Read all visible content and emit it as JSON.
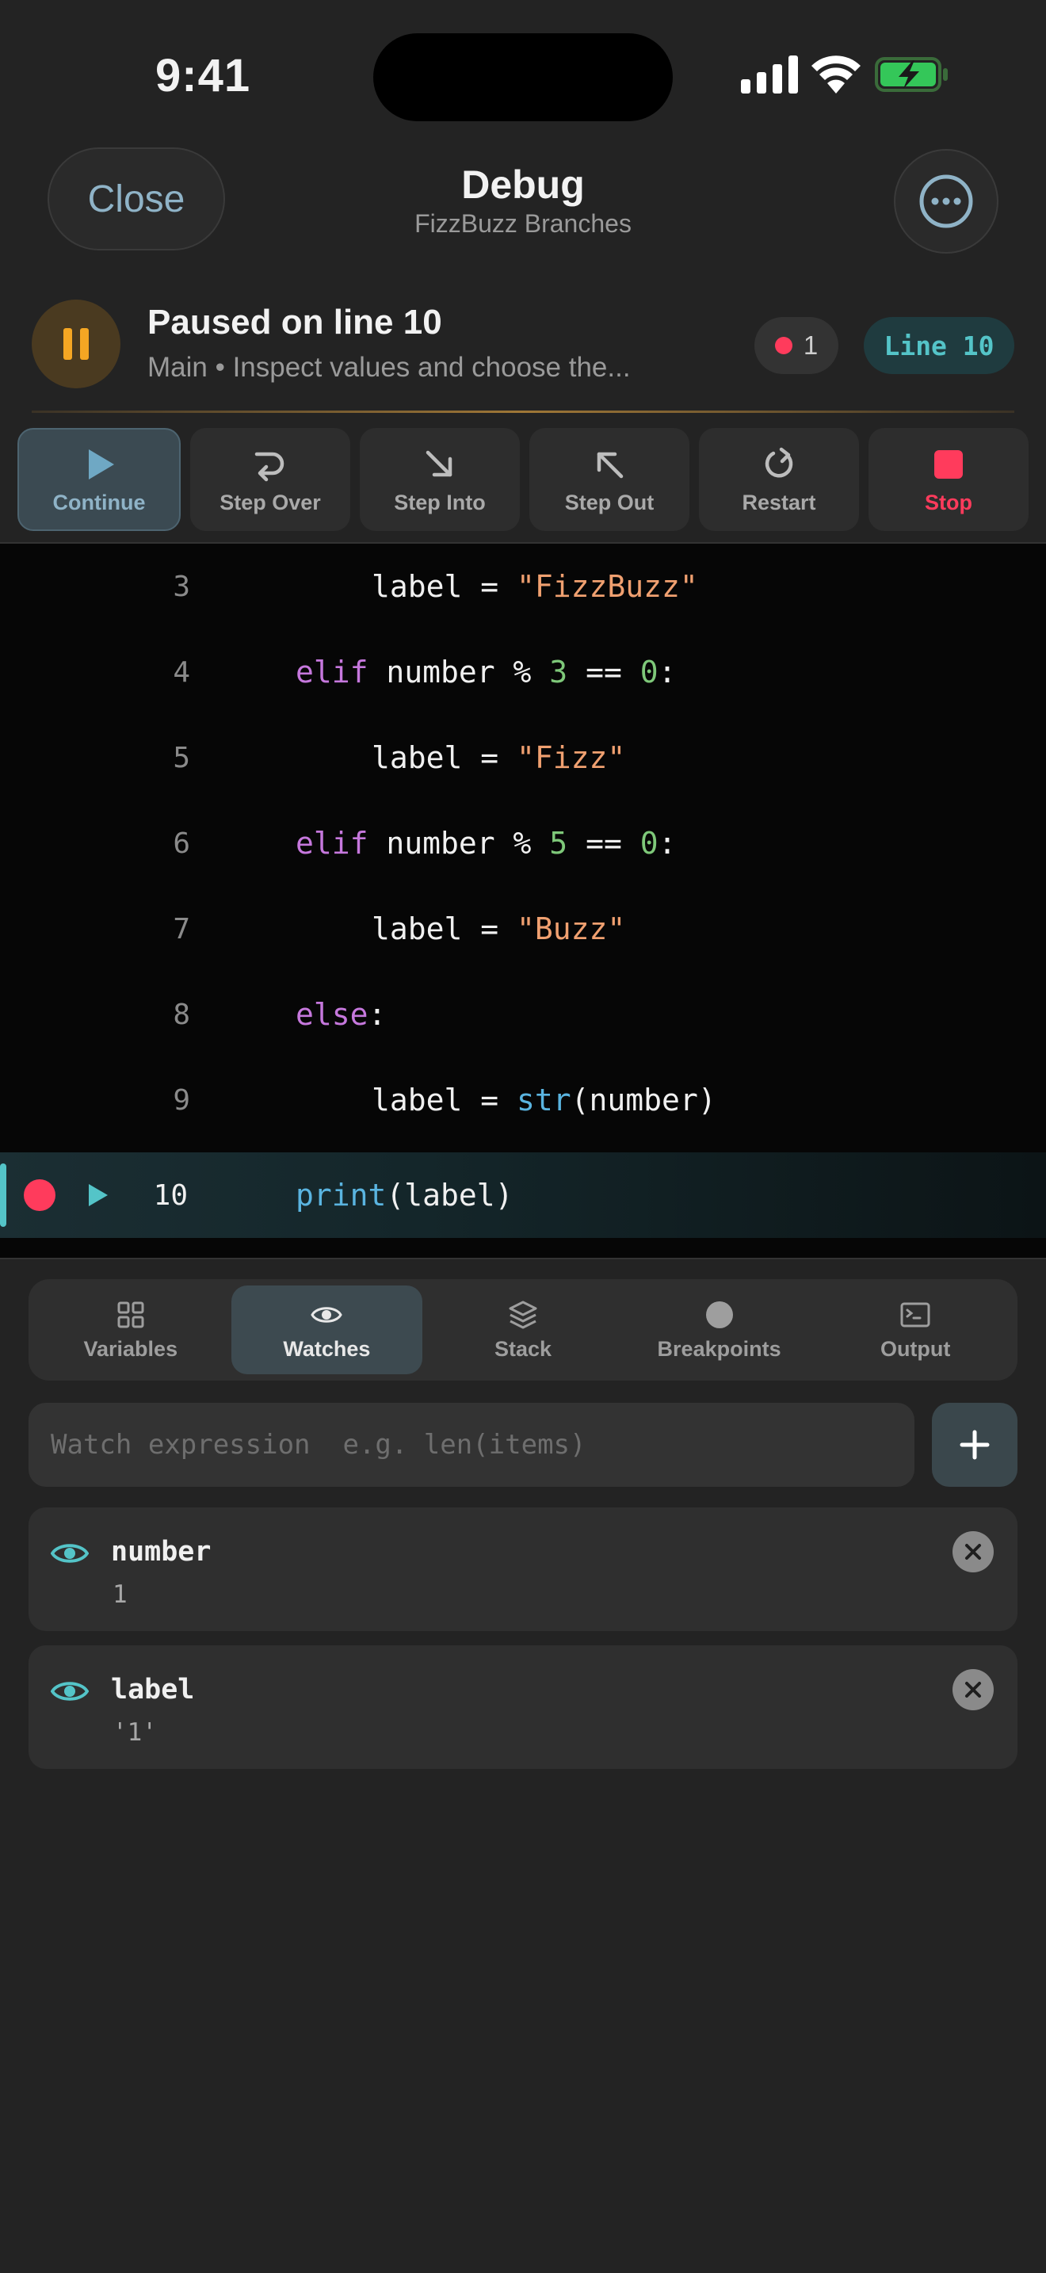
{
  "status_bar": {
    "time": "9:41"
  },
  "nav": {
    "close_label": "Close",
    "title": "Debug",
    "subtitle": "FizzBuzz Branches"
  },
  "banner": {
    "title": "Paused on line 10",
    "subtitle": "Main • Inspect values and choose the...",
    "breakpoint_count": "1",
    "line_badge": "Line 10",
    "accent_color": "#f5a623"
  },
  "toolbar": {
    "items": [
      {
        "label": "Continue",
        "icon": "play-icon",
        "active": true
      },
      {
        "label": "Step Over",
        "icon": "step-over-icon"
      },
      {
        "label": "Step Into",
        "icon": "step-into-icon"
      },
      {
        "label": "Step Out",
        "icon": "step-out-icon"
      },
      {
        "label": "Restart",
        "icon": "restart-icon"
      },
      {
        "label": "Stop",
        "icon": "stop-icon",
        "color": "#ff3b5c"
      }
    ]
  },
  "code": {
    "current_line": 10,
    "breakpoint_line": 10,
    "lines": [
      {
        "number": "3",
        "text": "label = \"FizzBuzz\""
      },
      {
        "number": "4",
        "text": "elif number % 3 == 0:"
      },
      {
        "number": "5",
        "text": "label = \"Fizz\""
      },
      {
        "number": "6",
        "text": "elif number % 5 == 0:"
      },
      {
        "number": "7",
        "text": "label = \"Buzz\""
      },
      {
        "number": "8",
        "text": "else:"
      },
      {
        "number": "9",
        "text": "label = str(number)"
      },
      {
        "number": "10",
        "text": "print(label)"
      }
    ]
  },
  "tabs": {
    "items": [
      {
        "label": "Variables",
        "icon": "grid-icon"
      },
      {
        "label": "Watches",
        "icon": "eye-icon",
        "active": true
      },
      {
        "label": "Stack",
        "icon": "layers-icon"
      },
      {
        "label": "Breakpoints",
        "icon": "circle-icon"
      },
      {
        "label": "Output",
        "icon": "terminal-icon"
      }
    ]
  },
  "watch": {
    "placeholder": "Watch expression  e.g. len(items)",
    "value": "",
    "items": [
      {
        "name": "number",
        "value": "1"
      },
      {
        "name": "label",
        "value": "'1'"
      }
    ]
  },
  "colors": {
    "accent": "#54c4c8",
    "breakpoint": "#ff3b5c",
    "keyword": "#c678dd",
    "string": "#f0a070",
    "number": "#7ec879"
  }
}
